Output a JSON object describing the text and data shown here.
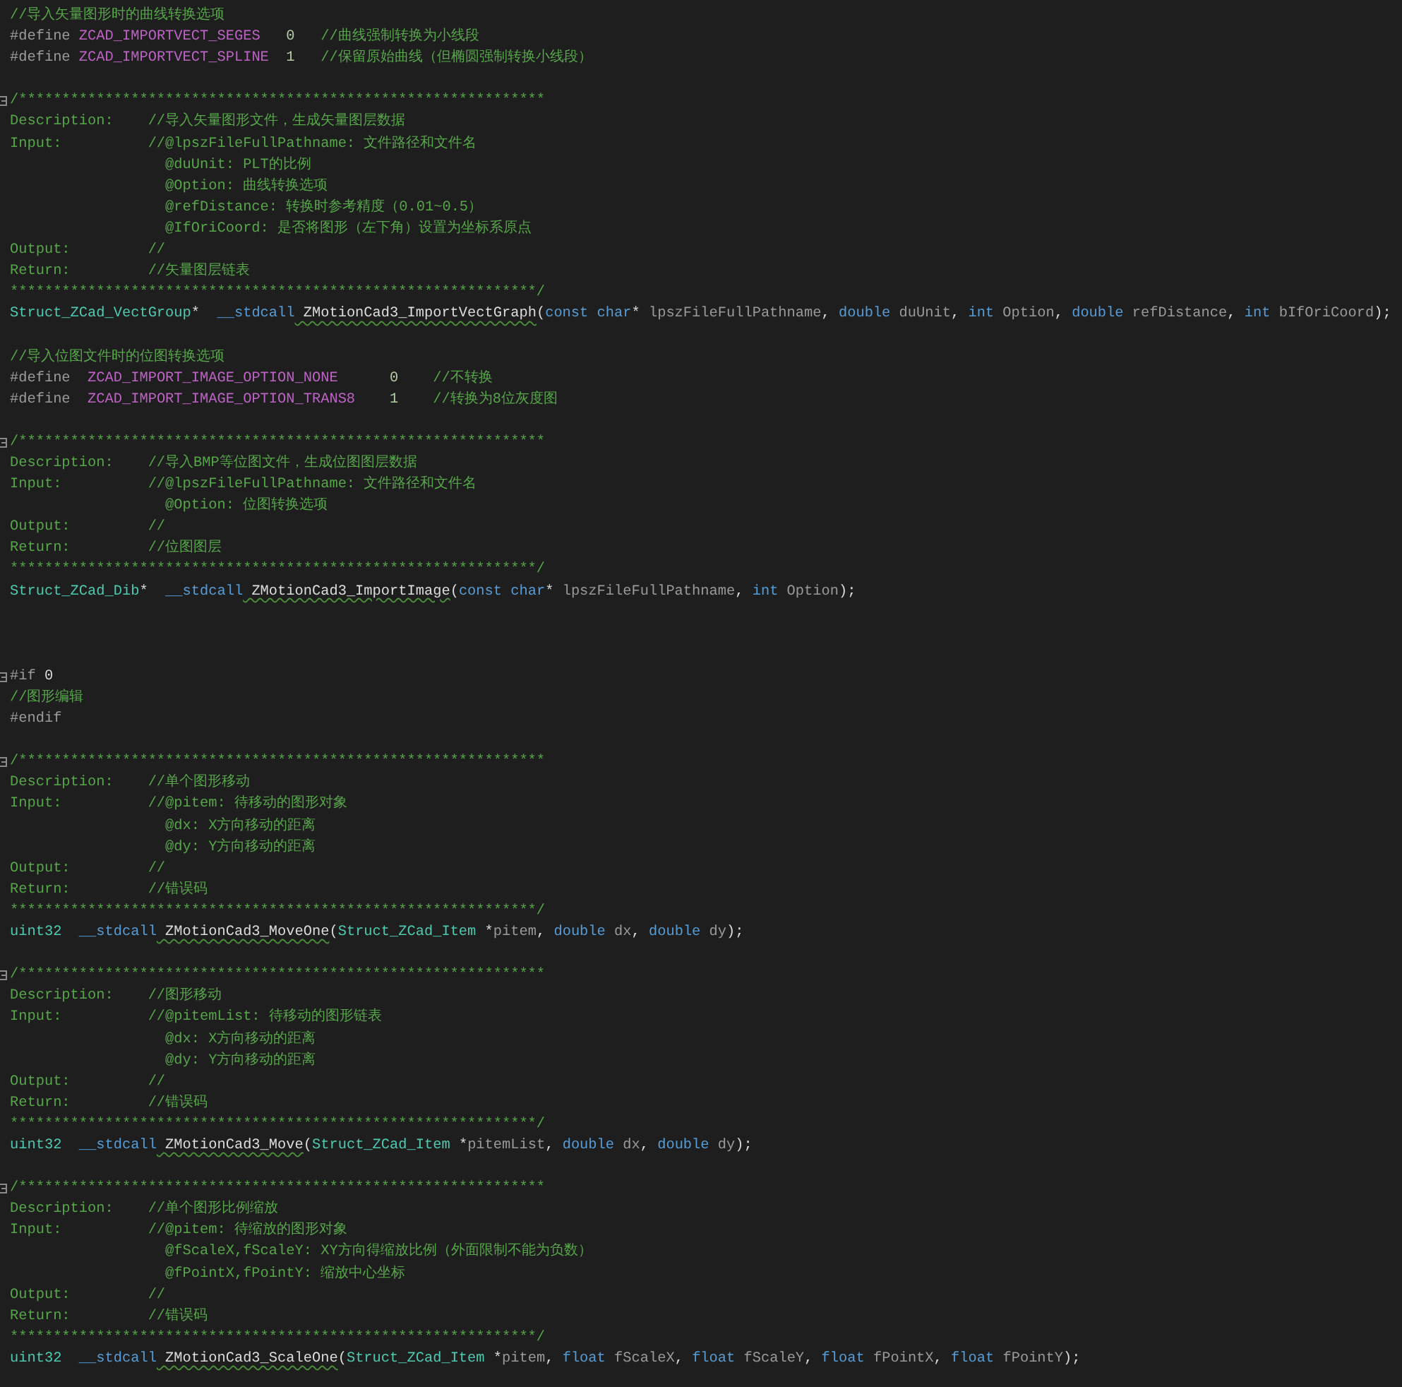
{
  "editor": {
    "lines": [
      {
        "kind": "code",
        "tokens": [
          {
            "kind": "comment",
            "text": "//导入矢量图形时的曲线转换选项"
          }
        ]
      },
      {
        "kind": "code",
        "tokens": [
          {
            "kind": "preproc",
            "text": "#define "
          },
          {
            "kind": "macro",
            "text": "ZCAD_IMPORTVECT_SEGES"
          },
          {
            "kind": "number",
            "text": "   0"
          },
          {
            "kind": "comment",
            "text": "   //曲线强制转换为小线段"
          }
        ]
      },
      {
        "kind": "code",
        "tokens": [
          {
            "kind": "preproc",
            "text": "#define "
          },
          {
            "kind": "macro",
            "text": "ZCAD_IMPORTVECT_SPLINE"
          },
          {
            "kind": "number",
            "text": "  1"
          },
          {
            "kind": "comment",
            "text": "   //保留原始曲线（但椭圆强制转换小线段）"
          }
        ]
      },
      {
        "kind": "blank"
      },
      {
        "kind": "code",
        "fold": true,
        "tokens": [
          {
            "kind": "comment",
            "text": "/*************************************************************"
          }
        ]
      },
      {
        "kind": "code",
        "tokens": [
          {
            "kind": "comment",
            "text": "Description:    //导入矢量图形文件，生成矢量图层数据"
          }
        ]
      },
      {
        "kind": "code",
        "tokens": [
          {
            "kind": "comment",
            "text": "Input:          //@lpszFileFullPathname: 文件路径和文件名"
          }
        ]
      },
      {
        "kind": "code",
        "tokens": [
          {
            "kind": "comment",
            "text": "                  @duUnit: PLT的比例"
          }
        ]
      },
      {
        "kind": "code",
        "tokens": [
          {
            "kind": "comment",
            "text": "                  @Option: 曲线转换选项"
          }
        ]
      },
      {
        "kind": "code",
        "tokens": [
          {
            "kind": "comment",
            "text": "                  @refDistance: 转换时参考精度（0.01~0.5）"
          }
        ]
      },
      {
        "kind": "code",
        "tokens": [
          {
            "kind": "comment",
            "text": "                  @IfOriCoord: 是否将图形（左下角）设置为坐标系原点"
          }
        ]
      },
      {
        "kind": "code",
        "tokens": [
          {
            "kind": "comment",
            "text": "Output:         //"
          }
        ]
      },
      {
        "kind": "code",
        "tokens": [
          {
            "kind": "comment",
            "text": "Return:         //矢量图层链表"
          }
        ]
      },
      {
        "kind": "code",
        "tokens": [
          {
            "kind": "comment",
            "text": "*************************************************************/"
          }
        ]
      },
      {
        "kind": "code",
        "tokens": [
          {
            "kind": "type",
            "text": "Struct_ZCad_VectGroup"
          },
          {
            "kind": "plain",
            "text": "*  "
          },
          {
            "kind": "keyword",
            "text": "__stdcall"
          },
          {
            "kind": "function",
            "text": " ZMotionCad3_ImportVectGraph",
            "squiggle": true
          },
          {
            "kind": "plain",
            "text": "("
          },
          {
            "kind": "keyword",
            "text": "const"
          },
          {
            "kind": "keyword",
            "text": " char"
          },
          {
            "kind": "plain",
            "text": "* "
          },
          {
            "kind": "param",
            "text": "lpszFileFullPathname"
          },
          {
            "kind": "plain",
            "text": ", "
          },
          {
            "kind": "keyword",
            "text": "double"
          },
          {
            "kind": "param",
            "text": " duUnit"
          },
          {
            "kind": "plain",
            "text": ", "
          },
          {
            "kind": "keyword",
            "text": "int"
          },
          {
            "kind": "param",
            "text": " Option"
          },
          {
            "kind": "plain",
            "text": ", "
          },
          {
            "kind": "keyword",
            "text": "double"
          },
          {
            "kind": "param",
            "text": " refDistance"
          },
          {
            "kind": "plain",
            "text": ", "
          },
          {
            "kind": "keyword",
            "text": "int"
          },
          {
            "kind": "param",
            "text": " bIfOriCoord"
          },
          {
            "kind": "plain",
            "text": ");"
          }
        ]
      },
      {
        "kind": "blank"
      },
      {
        "kind": "code",
        "tokens": [
          {
            "kind": "comment",
            "text": "//导入位图文件时的位图转换选项"
          }
        ]
      },
      {
        "kind": "code",
        "tokens": [
          {
            "kind": "preproc",
            "text": "#define  "
          },
          {
            "kind": "macro",
            "text": "ZCAD_IMPORT_IMAGE_OPTION_NONE"
          },
          {
            "kind": "number",
            "text": "      0"
          },
          {
            "kind": "comment",
            "text": "    //不转换"
          }
        ]
      },
      {
        "kind": "code",
        "tokens": [
          {
            "kind": "preproc",
            "text": "#define  "
          },
          {
            "kind": "macro",
            "text": "ZCAD_IMPORT_IMAGE_OPTION_TRANS8"
          },
          {
            "kind": "number",
            "text": "    1"
          },
          {
            "kind": "comment",
            "text": "    //转换为8位灰度图"
          }
        ]
      },
      {
        "kind": "blank"
      },
      {
        "kind": "code",
        "fold": true,
        "tokens": [
          {
            "kind": "comment",
            "text": "/*************************************************************"
          }
        ]
      },
      {
        "kind": "code",
        "tokens": [
          {
            "kind": "comment",
            "text": "Description:    //导入BMP等位图文件，生成位图图层数据"
          }
        ]
      },
      {
        "kind": "code",
        "tokens": [
          {
            "kind": "comment",
            "text": "Input:          //@lpszFileFullPathname: 文件路径和文件名"
          }
        ]
      },
      {
        "kind": "code",
        "tokens": [
          {
            "kind": "comment",
            "text": "                  @Option: 位图转换选项"
          }
        ]
      },
      {
        "kind": "code",
        "tokens": [
          {
            "kind": "comment",
            "text": "Output:         //"
          }
        ]
      },
      {
        "kind": "code",
        "tokens": [
          {
            "kind": "comment",
            "text": "Return:         //位图图层"
          }
        ]
      },
      {
        "kind": "code",
        "tokens": [
          {
            "kind": "comment",
            "text": "*************************************************************/"
          }
        ]
      },
      {
        "kind": "code",
        "tokens": [
          {
            "kind": "type",
            "text": "Struct_ZCad_Dib"
          },
          {
            "kind": "plain",
            "text": "*  "
          },
          {
            "kind": "keyword",
            "text": "__stdcall"
          },
          {
            "kind": "function",
            "text": " ZMotionCad3_ImportImage",
            "squiggle": true
          },
          {
            "kind": "plain",
            "text": "("
          },
          {
            "kind": "keyword",
            "text": "const"
          },
          {
            "kind": "keyword",
            "text": " char"
          },
          {
            "kind": "plain",
            "text": "* "
          },
          {
            "kind": "param",
            "text": "lpszFileFullPathname"
          },
          {
            "kind": "plain",
            "text": ", "
          },
          {
            "kind": "keyword",
            "text": "int"
          },
          {
            "kind": "param",
            "text": " Option"
          },
          {
            "kind": "plain",
            "text": ");"
          }
        ]
      },
      {
        "kind": "blank"
      },
      {
        "kind": "blank"
      },
      {
        "kind": "blank"
      },
      {
        "kind": "code",
        "fold": true,
        "tokens": [
          {
            "kind": "preproc",
            "text": "#if"
          },
          {
            "kind": "plain",
            "text": " 0"
          }
        ]
      },
      {
        "kind": "code",
        "tokens": [
          {
            "kind": "comment",
            "text": "//图形编辑"
          }
        ]
      },
      {
        "kind": "code",
        "tokens": [
          {
            "kind": "preproc",
            "text": "#endif"
          }
        ]
      },
      {
        "kind": "blank"
      },
      {
        "kind": "code",
        "fold": true,
        "tokens": [
          {
            "kind": "comment",
            "text": "/*************************************************************"
          }
        ]
      },
      {
        "kind": "code",
        "tokens": [
          {
            "kind": "comment",
            "text": "Description:    //单个图形移动"
          }
        ]
      },
      {
        "kind": "code",
        "tokens": [
          {
            "kind": "comment",
            "text": "Input:          //@pitem: 待移动的图形对象"
          }
        ]
      },
      {
        "kind": "code",
        "tokens": [
          {
            "kind": "comment",
            "text": "                  @dx: X方向移动的距离"
          }
        ]
      },
      {
        "kind": "code",
        "tokens": [
          {
            "kind": "comment",
            "text": "                  @dy: Y方向移动的距离"
          }
        ]
      },
      {
        "kind": "code",
        "tokens": [
          {
            "kind": "comment",
            "text": "Output:         //"
          }
        ]
      },
      {
        "kind": "code",
        "tokens": [
          {
            "kind": "comment",
            "text": "Return:         //错误码"
          }
        ]
      },
      {
        "kind": "code",
        "tokens": [
          {
            "kind": "comment",
            "text": "*************************************************************/"
          }
        ]
      },
      {
        "kind": "code",
        "tokens": [
          {
            "kind": "type",
            "text": "uint32"
          },
          {
            "kind": "keyword",
            "text": "  __stdcall"
          },
          {
            "kind": "function",
            "text": " ZMotionCad3_MoveOne",
            "squiggle": true
          },
          {
            "kind": "plain",
            "text": "("
          },
          {
            "kind": "type",
            "text": "Struct_ZCad_Item"
          },
          {
            "kind": "plain",
            "text": " *"
          },
          {
            "kind": "param",
            "text": "pitem"
          },
          {
            "kind": "plain",
            "text": ", "
          },
          {
            "kind": "keyword",
            "text": "double"
          },
          {
            "kind": "param",
            "text": " dx"
          },
          {
            "kind": "plain",
            "text": ", "
          },
          {
            "kind": "keyword",
            "text": "double"
          },
          {
            "kind": "param",
            "text": " dy"
          },
          {
            "kind": "plain",
            "text": ");"
          }
        ]
      },
      {
        "kind": "blank"
      },
      {
        "kind": "code",
        "fold": true,
        "tokens": [
          {
            "kind": "comment",
            "text": "/*************************************************************"
          }
        ]
      },
      {
        "kind": "code",
        "tokens": [
          {
            "kind": "comment",
            "text": "Description:    //图形移动"
          }
        ]
      },
      {
        "kind": "code",
        "tokens": [
          {
            "kind": "comment",
            "text": "Input:          //@pitemList: 待移动的图形链表"
          }
        ]
      },
      {
        "kind": "code",
        "tokens": [
          {
            "kind": "comment",
            "text": "                  @dx: X方向移动的距离"
          }
        ]
      },
      {
        "kind": "code",
        "tokens": [
          {
            "kind": "comment",
            "text": "                  @dy: Y方向移动的距离"
          }
        ]
      },
      {
        "kind": "code",
        "tokens": [
          {
            "kind": "comment",
            "text": "Output:         //"
          }
        ]
      },
      {
        "kind": "code",
        "tokens": [
          {
            "kind": "comment",
            "text": "Return:         //错误码"
          }
        ]
      },
      {
        "kind": "code",
        "tokens": [
          {
            "kind": "comment",
            "text": "*************************************************************/"
          }
        ]
      },
      {
        "kind": "code",
        "tokens": [
          {
            "kind": "type",
            "text": "uint32"
          },
          {
            "kind": "keyword",
            "text": "  __stdcall"
          },
          {
            "kind": "function",
            "text": " ZMotionCad3_Move",
            "squiggle": true
          },
          {
            "kind": "plain",
            "text": "("
          },
          {
            "kind": "type",
            "text": "Struct_ZCad_Item"
          },
          {
            "kind": "plain",
            "text": " *"
          },
          {
            "kind": "param",
            "text": "pitemList"
          },
          {
            "kind": "plain",
            "text": ", "
          },
          {
            "kind": "keyword",
            "text": "double"
          },
          {
            "kind": "param",
            "text": " dx"
          },
          {
            "kind": "plain",
            "text": ", "
          },
          {
            "kind": "keyword",
            "text": "double"
          },
          {
            "kind": "param",
            "text": " dy"
          },
          {
            "kind": "plain",
            "text": ");"
          }
        ]
      },
      {
        "kind": "blank"
      },
      {
        "kind": "code",
        "fold": true,
        "tokens": [
          {
            "kind": "comment",
            "text": "/*************************************************************"
          }
        ]
      },
      {
        "kind": "code",
        "tokens": [
          {
            "kind": "comment",
            "text": "Description:    //单个图形比例缩放"
          }
        ]
      },
      {
        "kind": "code",
        "tokens": [
          {
            "kind": "comment",
            "text": "Input:          //@pitem: 待缩放的图形对象"
          }
        ]
      },
      {
        "kind": "code",
        "tokens": [
          {
            "kind": "comment",
            "text": "                  @fScaleX,fScaleY: XY方向得缩放比例（外面限制不能为负数）"
          }
        ]
      },
      {
        "kind": "code",
        "tokens": [
          {
            "kind": "comment",
            "text": "                  @fPointX,fPointY: 缩放中心坐标"
          }
        ]
      },
      {
        "kind": "code",
        "tokens": [
          {
            "kind": "comment",
            "text": "Output:         //"
          }
        ]
      },
      {
        "kind": "code",
        "tokens": [
          {
            "kind": "comment",
            "text": "Return:         //错误码"
          }
        ]
      },
      {
        "kind": "code",
        "tokens": [
          {
            "kind": "comment",
            "text": "*************************************************************/"
          }
        ]
      },
      {
        "kind": "code",
        "tokens": [
          {
            "kind": "type",
            "text": "uint32"
          },
          {
            "kind": "keyword",
            "text": "  __stdcall"
          },
          {
            "kind": "function",
            "text": " ZMotionCad3_ScaleOne",
            "squiggle": true
          },
          {
            "kind": "plain",
            "text": "("
          },
          {
            "kind": "type",
            "text": "Struct_ZCad_Item"
          },
          {
            "kind": "plain",
            "text": " *"
          },
          {
            "kind": "param",
            "text": "pitem"
          },
          {
            "kind": "plain",
            "text": ", "
          },
          {
            "kind": "keyword",
            "text": "float"
          },
          {
            "kind": "param",
            "text": " fScaleX"
          },
          {
            "kind": "plain",
            "text": ", "
          },
          {
            "kind": "keyword",
            "text": "float"
          },
          {
            "kind": "param",
            "text": " fScaleY"
          },
          {
            "kind": "plain",
            "text": ", "
          },
          {
            "kind": "keyword",
            "text": "float"
          },
          {
            "kind": "param",
            "text": " fPointX"
          },
          {
            "kind": "plain",
            "text": ", "
          },
          {
            "kind": "keyword",
            "text": "float"
          },
          {
            "kind": "param",
            "text": " fPointY"
          },
          {
            "kind": "plain",
            "text": ");"
          }
        ]
      }
    ]
  }
}
